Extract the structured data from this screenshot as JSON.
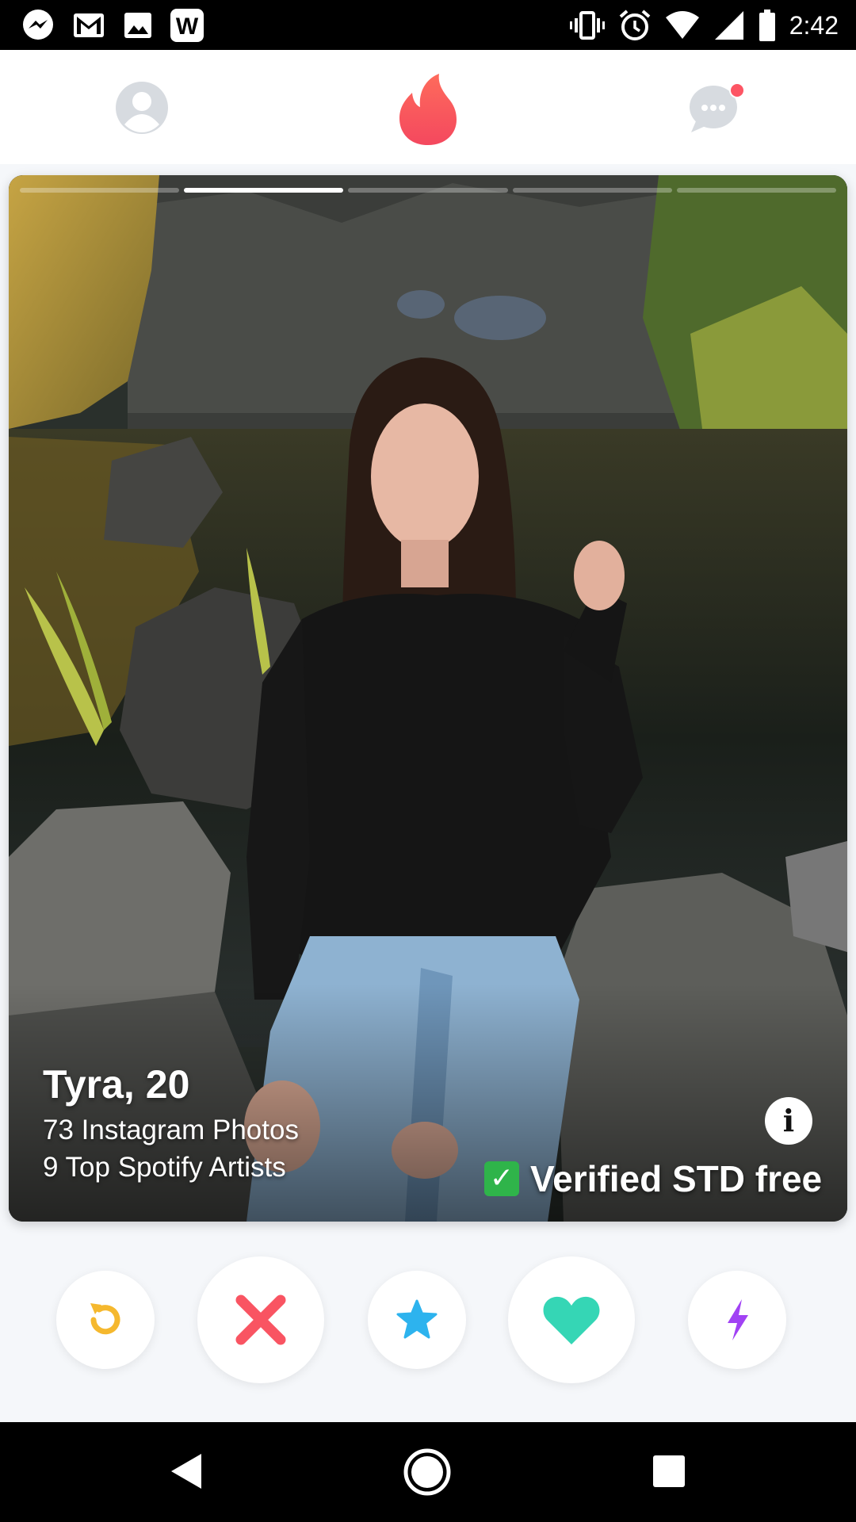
{
  "status_bar": {
    "time": "2:42",
    "left_icons": [
      "messenger-icon",
      "gmail-icon",
      "image-icon",
      "w-app-icon"
    ],
    "right_icons": [
      "vibrate-icon",
      "alarm-icon",
      "wifi-icon",
      "signal-icon",
      "battery-icon"
    ]
  },
  "top_nav": {
    "items": [
      "profile-icon",
      "flame-icon",
      "chat-icon"
    ],
    "chat_has_notification": true,
    "brand_color": "#fd5564"
  },
  "card": {
    "photo_count": 5,
    "active_photo": 1,
    "name": "Tyra,",
    "age": "20",
    "detail_1": "73 Instagram Photos",
    "detail_2": "9 Top Spotify Artists",
    "info_label": "i",
    "verified_check": "✓",
    "verified_text": "Verified STD free"
  },
  "actions": [
    {
      "name": "rewind-button",
      "icon": "rewind-icon",
      "color": "#f5b82e"
    },
    {
      "name": "nope-button",
      "icon": "x-icon",
      "color": "#f95462"
    },
    {
      "name": "super-like-button",
      "icon": "star-icon",
      "color": "#2db3ee"
    },
    {
      "name": "like-button",
      "icon": "heart-icon",
      "color": "#35d6b5"
    },
    {
      "name": "boost-button",
      "icon": "bolt-icon",
      "color": "#a142f4"
    }
  ],
  "android_nav": [
    "back-icon",
    "home-icon",
    "recents-icon"
  ]
}
